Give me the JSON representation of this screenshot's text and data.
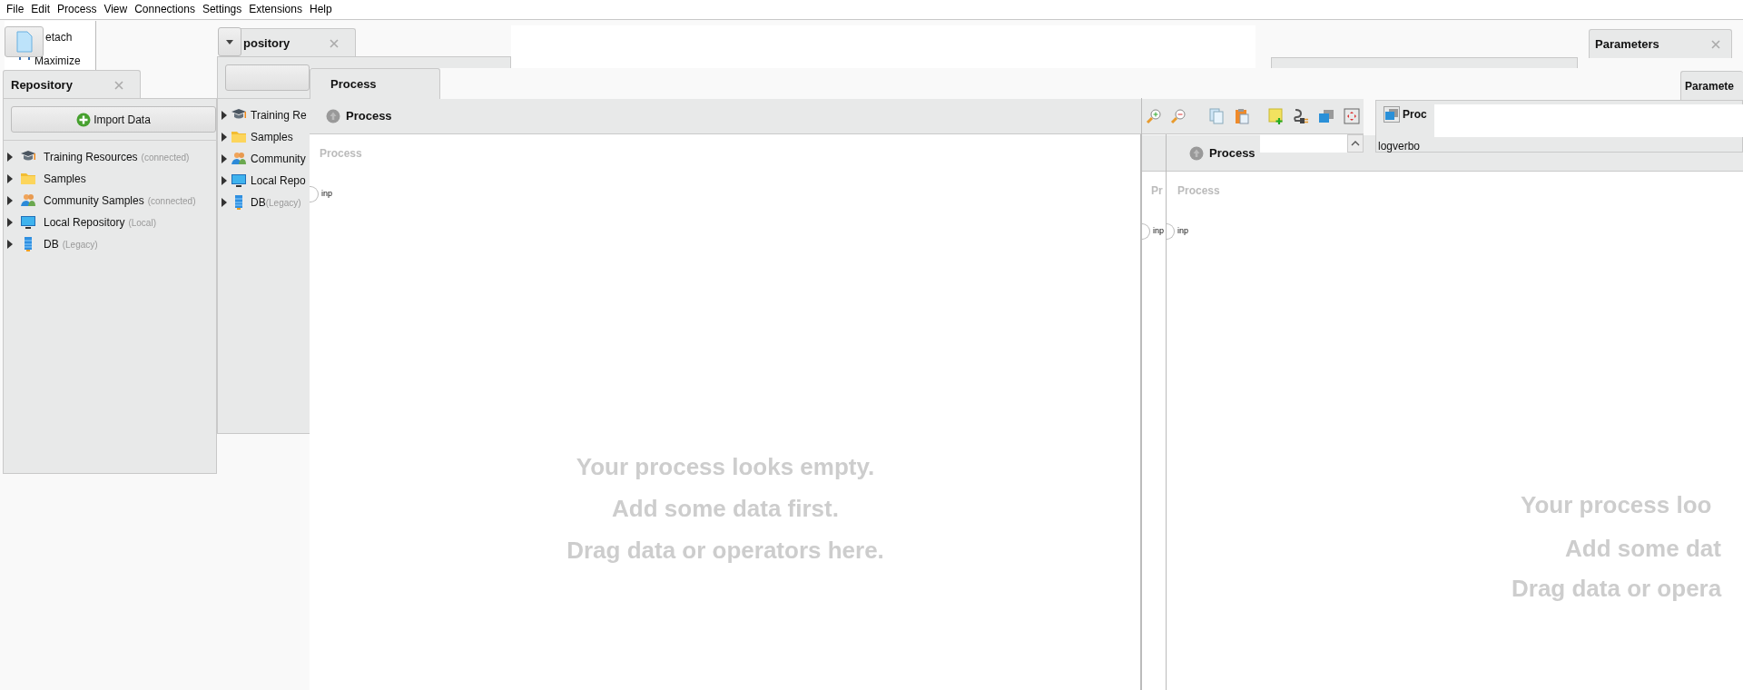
{
  "menu_bar": [
    {
      "label": "File"
    },
    {
      "label": "Edit"
    },
    {
      "label": "Process"
    },
    {
      "label": "View"
    },
    {
      "label": "Connections"
    },
    {
      "label": "Settings"
    },
    {
      "label": "Extensions"
    },
    {
      "label": "Help"
    }
  ],
  "popup_menu": {
    "items": [
      {
        "label": "etach",
        "kind": "detach"
      },
      {
        "label": "Maximize",
        "kind": "maximize"
      }
    ]
  },
  "repository_panels": [
    {
      "tab": "Repository",
      "import_button": "Import Data",
      "items": [
        {
          "label": "Training Resources",
          "note": "(connected)",
          "kind": "training"
        },
        {
          "label": "Samples",
          "kind": "folder"
        },
        {
          "label": "Community Samples",
          "note": "(connected)",
          "kind": "community"
        },
        {
          "label": "Local Repository",
          "note": "(Local)",
          "kind": "monitor"
        },
        {
          "label": "DB",
          "note": "(Legacy)",
          "kind": "database"
        }
      ]
    },
    {
      "tab": "pository",
      "items": [
        {
          "label": "Training Re",
          "kind": "training"
        },
        {
          "label": "Samples",
          "kind": "folder"
        },
        {
          "label": "Community",
          "kind": "community"
        },
        {
          "label": "Local Repo",
          "kind": "monitor"
        },
        {
          "label": "DB",
          "note": "(Legacy)",
          "kind": "database"
        }
      ]
    }
  ],
  "process_panels": [
    {
      "tab": "Process",
      "header": "Process",
      "canvas_labels": [
        "Process"
      ],
      "ports": [
        "inp"
      ],
      "empty_message": [
        "Your process looks empty.",
        "Add some data first.",
        "Drag data or operators here."
      ]
    },
    {
      "header": "Process",
      "canvas_labels": [
        "Pr",
        "Process"
      ],
      "ports": [
        "inp",
        "inp"
      ],
      "empty_message": [
        "Your process loo",
        "Add some dat",
        "Drag data or opera"
      ]
    }
  ],
  "parameters": {
    "tabs": [
      "Parameters",
      "Paramete"
    ],
    "operator": "Proc",
    "row_label": "logverbo"
  }
}
